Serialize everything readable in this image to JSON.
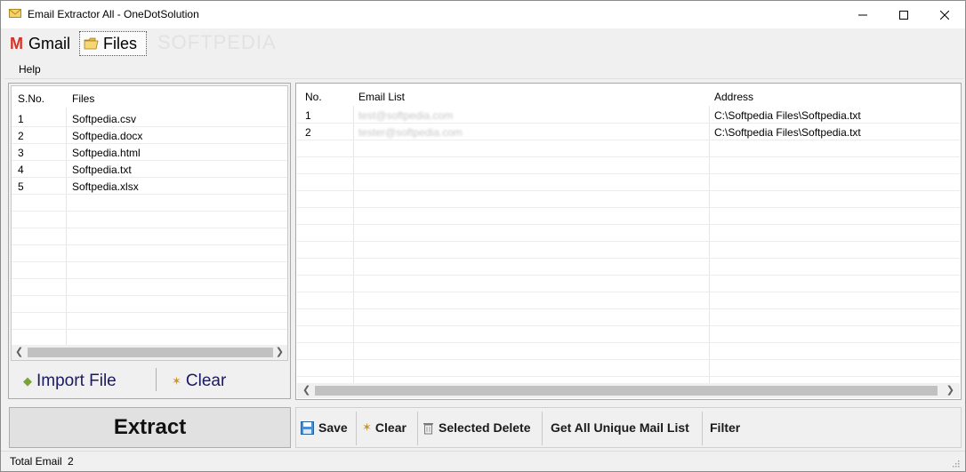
{
  "window": {
    "title": "Email Extractor All - OneDotSolution",
    "watermark": "Softpedia"
  },
  "tabs": [
    {
      "label": "Gmail",
      "icon": "gmail-icon"
    },
    {
      "label": "Files",
      "icon": "folder-icon",
      "active": true
    }
  ],
  "menu": {
    "help": "Help"
  },
  "files": {
    "columns": [
      "S.No.",
      "Files"
    ],
    "rows": [
      [
        "1",
        "Softpedia.csv"
      ],
      [
        "2",
        "Softpedia.docx"
      ],
      [
        "3",
        "Softpedia.html"
      ],
      [
        "4",
        "Softpedia.txt"
      ],
      [
        "5",
        "Softpedia.xlsx"
      ]
    ],
    "import_label": "Import File",
    "clear_label": "Clear"
  },
  "emails": {
    "columns": [
      "No.",
      "Email List",
      "Address"
    ],
    "rows": [
      [
        "1",
        "test@softpedia.com",
        "C:\\Softpedia Files\\Softpedia.txt"
      ],
      [
        "2",
        "tester@softpedia.com",
        "C:\\Softpedia Files\\Softpedia.txt"
      ]
    ]
  },
  "extract_label": "Extract",
  "toolbar": {
    "save": "Save",
    "clear": "Clear",
    "selected_delete": "Selected Delete",
    "unique": "Get All Unique Mail List",
    "filter": "Filter"
  },
  "status": {
    "label": "Total Email",
    "count": "2"
  },
  "colors": {
    "window_bg": "#f0f0f0",
    "grid_bg": "#ffffff",
    "action_text": "#1a1a5e",
    "gmail_red": "#d93025"
  }
}
